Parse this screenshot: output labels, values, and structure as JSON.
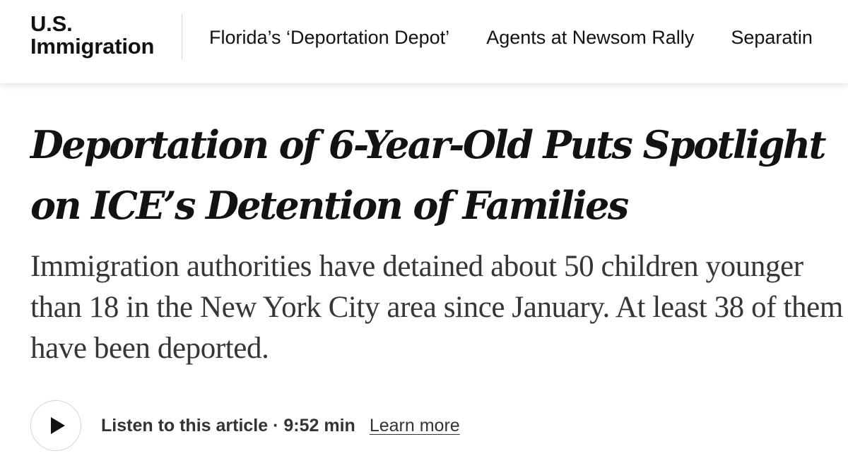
{
  "header": {
    "section_line1": "U.S.",
    "section_line2": "Immigration",
    "nav_items": [
      "Florida’s ‘Deportation Depot’",
      "Agents at Newsom Rally",
      "Separatin"
    ]
  },
  "article": {
    "headline": "Deportation of 6-Year-Old Puts Spotlight on ICE’s Detention of Families",
    "summary": "Immigration authorities have detained about 50 children younger than 18 in the New York City area since January. At least 38 of them have been deported."
  },
  "audio": {
    "play_icon": "play-icon",
    "listen_label": "Listen to this article",
    "separator": " · ",
    "duration": "9:52 min",
    "learn_more": "Learn more"
  }
}
